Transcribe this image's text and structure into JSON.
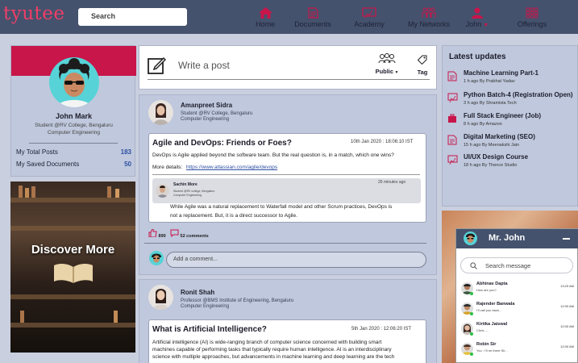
{
  "header": {
    "logo": "tyutee",
    "search_placeholder": "Search",
    "nav": [
      {
        "label": "Home"
      },
      {
        "label": "Documents"
      },
      {
        "label": "Academy"
      },
      {
        "label": "My Networks"
      },
      {
        "label": "John"
      },
      {
        "label": "Offerings"
      }
    ]
  },
  "profile": {
    "name": "John Mark",
    "sub1": "Student @RV College, Bengaluru",
    "sub2": "Computer Engineering",
    "stats": [
      {
        "label": "My Total Posts",
        "value": "183"
      },
      {
        "label": "My Saved Documents",
        "value": "50"
      }
    ]
  },
  "discover": {
    "label": "Discover More"
  },
  "composer": {
    "placeholder": "Write a post",
    "public_label": "Public",
    "tag_label": "Tag"
  },
  "posts": [
    {
      "author": "Amanpreet Sidra",
      "sub1": "Student @RV College, Bengaluru",
      "sub2": "Computer Engineering",
      "title": "Agile and DevOps: Friends or Foes?",
      "date": "10th Jan 2020 : 18:06:10 IST",
      "body": "DevOps is Agile applied beyond the software team. But the real question is, in a match, which one wins?",
      "more_label": "More details:",
      "link": "https://www.atlassian.com/agile/devops",
      "reply": {
        "name": "Sachin More",
        "time": "26 minutes ago",
        "sub1": "Student @RV college, Bengaluru",
        "sub2": "Computer Engineering",
        "text1": "While Agile was a natural replacement to Waterfall model and other Scrum practices, DevOps is",
        "text2": "not a replacement. But, it is a direct successor to Agile."
      },
      "likes": "890",
      "comments": "52 comments",
      "comment_placeholder": "Add a comment..."
    },
    {
      "author": "Ronit Shah",
      "sub1": "Professor @BMS Institute of Engineering, Bengaluru",
      "sub2": "Computer Engineering",
      "title": "What is Artificial Intelligence?",
      "date": "5th Jan 2020 : 12:06:20 IST",
      "body1": "Artificial intelligence (AI) is wide-ranging branch of computer science concerned with building smart",
      "body2": "machines capable of performing tasks that typically require human intelligence. AI is an interdisciplinary",
      "body3": "science with multiple approaches, but advancements in machine learning and deep learning are the tech"
    }
  ],
  "updates": {
    "title": "Latest updates",
    "items": [
      {
        "title": "Machine Learning Part-1",
        "meta": "1 h ago    By Prabhat Yadav",
        "icon": "document-icon"
      },
      {
        "title": "Python Batch-4 (Registration Open)",
        "meta": "3 h ago    By Shramista Tech",
        "icon": "academy-icon"
      },
      {
        "title": "Full Stack Engineer (Job)",
        "meta": "8 h ago    By Amazon",
        "icon": "briefcase-icon"
      },
      {
        "title": "Digital Marketing (SEO)",
        "meta": "15 h ago    By Meenakshi Jain",
        "icon": "document-icon"
      },
      {
        "title": "UI/UX Design Course",
        "meta": "18 h ago    By Thence Studio",
        "icon": "academy-icon"
      }
    ]
  },
  "chat": {
    "title": "Mr. John",
    "search_placeholder": "Search message",
    "contacts": [
      {
        "name": "Abhinav Dapta",
        "msg": "How are you?",
        "time": "13:20 AM"
      },
      {
        "name": "Rajender Banwala",
        "msg": "I'll call you back...",
        "time": "12:00 AM"
      },
      {
        "name": "Kirtika Jaiswal",
        "msg": "Chris.....",
        "time": "12:00 AM"
      },
      {
        "name": "Robin Sir",
        "msg": "You : I'll ne there Sir...",
        "time": "12:00 AM"
      }
    ]
  },
  "colors": {
    "header": "#45526d",
    "brand": "#ef3e67",
    "profile_band": "#c8154a",
    "link": "#2d4ea3",
    "panel": "#bfc8dc"
  }
}
